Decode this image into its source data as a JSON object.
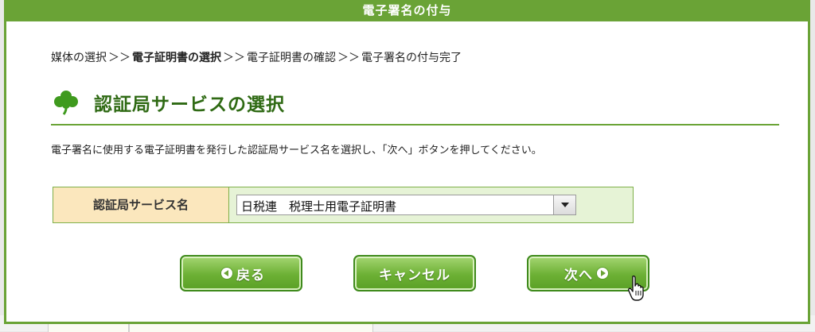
{
  "window": {
    "title": "電子署名の付与"
  },
  "breadcrumb": {
    "steps": [
      "媒体の選択",
      "電子証明書の選択",
      "電子証明書の確認",
      "電子署名の付与完了"
    ],
    "separator": "＞＞"
  },
  "section": {
    "title": "認証局サービスの選択"
  },
  "instruction": "電子署名に使用する電子証明書を発行した認証局サービス名を選択し、「次へ」ボタンを押してください。",
  "form": {
    "label": "認証局サービス名",
    "selected_value": "日税連　税理士用電子証明書"
  },
  "buttons": {
    "back": "戻る",
    "cancel": "キャンセル",
    "next": "次へ"
  },
  "colors": {
    "accent": "#6aa336",
    "heading": "#2f6a14",
    "label_bg": "#fbe7bd",
    "row_bg": "#e6f3d6"
  },
  "icons": {
    "section": "clover-icon",
    "back": "arrow-left-circle-icon",
    "next": "arrow-right-circle-icon",
    "pointer": "hand-cursor-icon"
  }
}
